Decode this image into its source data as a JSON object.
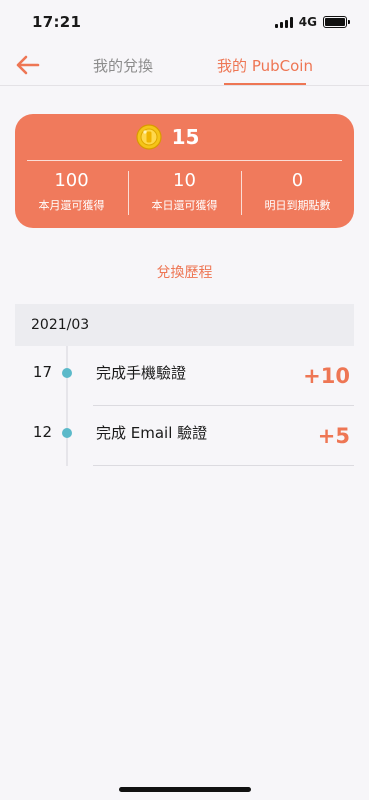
{
  "status_bar": {
    "time": "17:21",
    "network": "4G"
  },
  "nav": {
    "tabs": [
      {
        "label": "我的兌換",
        "active": false
      },
      {
        "label": "我的 PubCoin",
        "active": true
      }
    ]
  },
  "coin_card": {
    "balance": "15",
    "stats": [
      {
        "value": "100",
        "label": "本月還可獲得"
      },
      {
        "value": "10",
        "label": "本日還可獲得"
      },
      {
        "value": "0",
        "label": "明日到期點數"
      }
    ]
  },
  "history": {
    "title": "兌換歷程",
    "month": "2021/03",
    "entries": [
      {
        "day": "17",
        "text": "完成手機驗證",
        "points": "+10"
      },
      {
        "day": "12",
        "text": "完成 Email 驗證",
        "points": "+5"
      }
    ]
  },
  "colors": {
    "accent": "#f07a5c",
    "dot": "#5bb9c9",
    "background": "#f7f6f9"
  },
  "icons": [
    "back-arrow-icon",
    "coin-icon",
    "signal-icon",
    "battery-icon"
  ]
}
